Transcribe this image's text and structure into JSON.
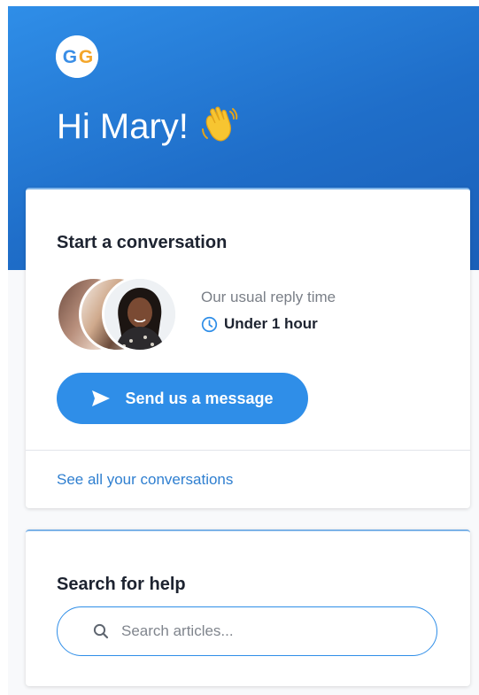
{
  "header": {
    "logo_text": "GG",
    "greeting": "Hi Mary!",
    "greeting_emoji_icon": "waving-hand-icon"
  },
  "conversation_card": {
    "title": "Start a conversation",
    "avatars": [
      "team-member-avatar",
      "team-member-avatar",
      "team-member-avatar"
    ],
    "reply_label": "Our usual reply time",
    "reply_time": "Under 1 hour",
    "reply_icon": "clock-icon",
    "send_button_label": "Send us a message",
    "send_button_icon": "send-icon",
    "see_all_link": "See all your conversations"
  },
  "help_card": {
    "title": "Search for help",
    "search_placeholder": "Search articles...",
    "search_value": "",
    "search_icon": "search-icon"
  },
  "colors": {
    "brand_blue": "#2f8ee8",
    "link_blue": "#2f7fd0",
    "logo_blue": "#3a8ee6",
    "logo_orange": "#f4a62a"
  }
}
